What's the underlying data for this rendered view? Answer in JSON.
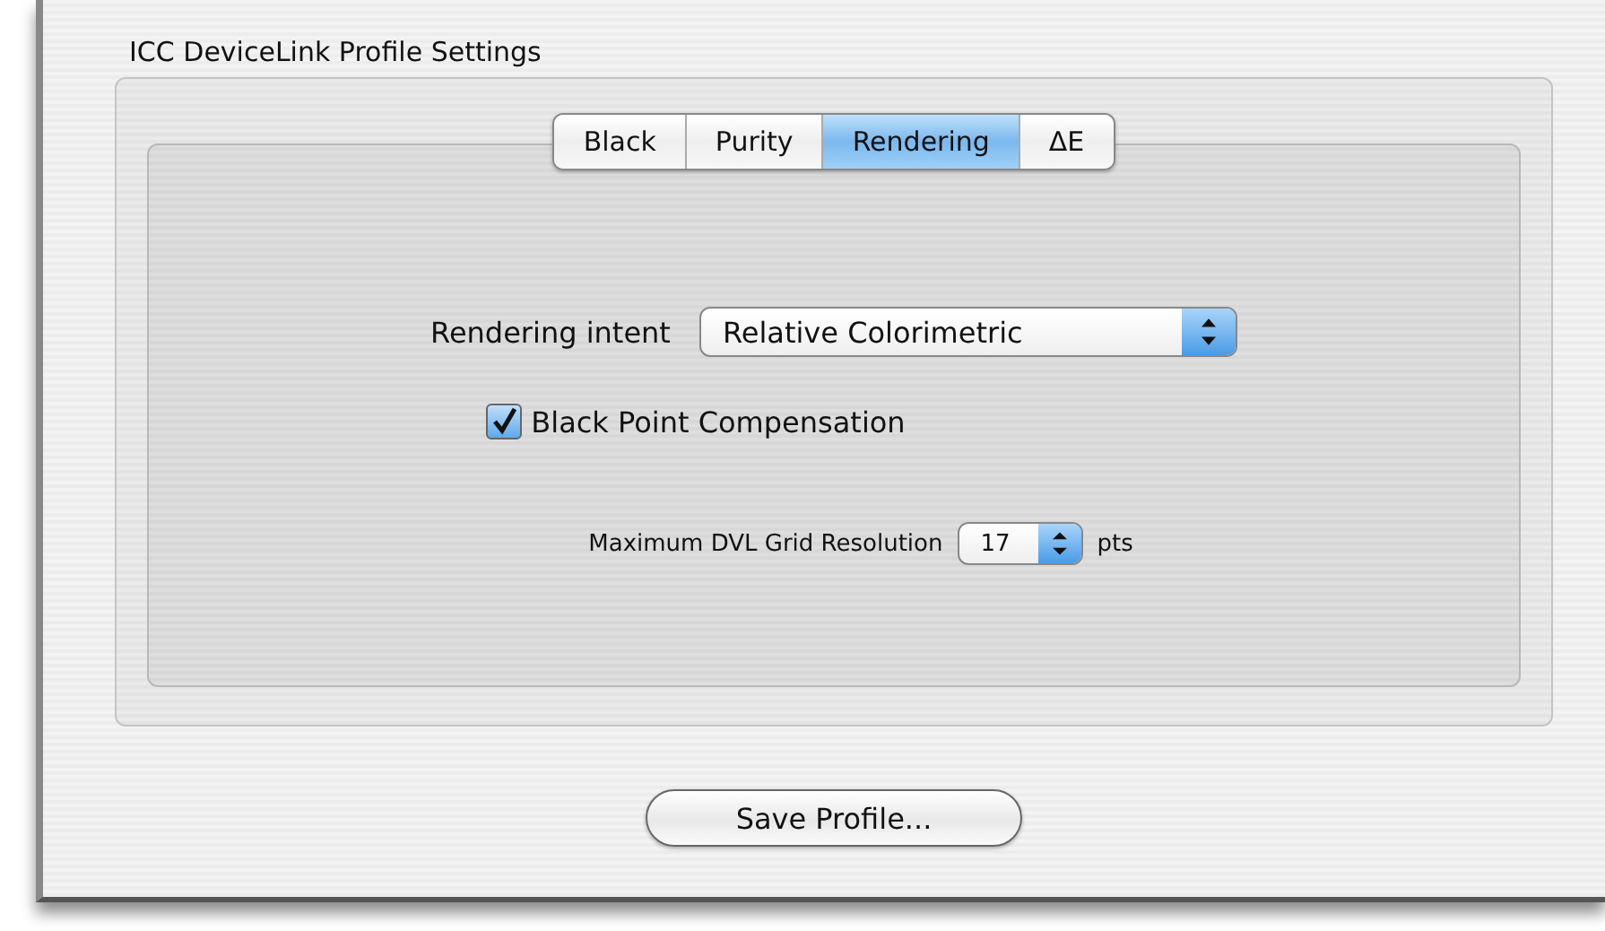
{
  "group": {
    "title": "ICC DeviceLink Profile Settings"
  },
  "tabs": [
    {
      "label": "Black",
      "selected": false
    },
    {
      "label": "Purity",
      "selected": false
    },
    {
      "label": "Rendering",
      "selected": true
    },
    {
      "label": "ΔE",
      "selected": false
    }
  ],
  "rendering_intent": {
    "label": "Rendering intent",
    "value": "Relative Colorimetric"
  },
  "black_point": {
    "label": "Black Point Compensation",
    "checked": true
  },
  "grid_resolution": {
    "label": "Maximum DVL Grid Resolution",
    "value": "17",
    "unit": "pts"
  },
  "save_button": "Save Profile..."
}
